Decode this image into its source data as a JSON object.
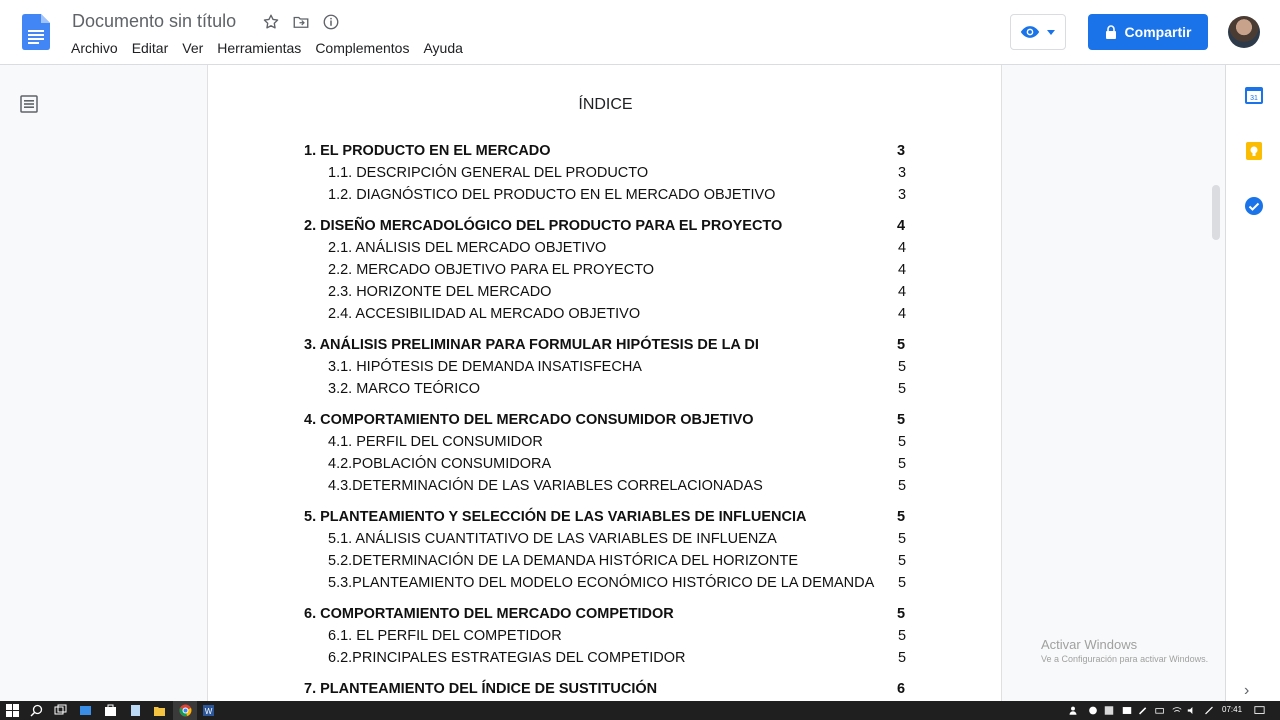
{
  "app": {
    "doc_title": "Documento sin título",
    "menu": [
      "Archivo",
      "Editar",
      "Ver",
      "Herramientas",
      "Complementos",
      "Ayuda"
    ],
    "share_label": "Compartir",
    "brand_color": "#1a73e8"
  },
  "document": {
    "heading": "ÍNDICE",
    "toc": [
      {
        "label": "1. EL PRODUCTO EN EL MERCADO",
        "page": "3",
        "level": 1
      },
      {
        "label": "1.1. DESCRIPCIÓN GENERAL DEL PRODUCTO",
        "page": "3",
        "level": 2
      },
      {
        "label": "1.2. DIAGNÓSTICO DEL PRODUCTO EN EL MERCADO OBJETIVO",
        "page": "3",
        "level": 2
      },
      {
        "label": "2. DISEÑO MERCADOLÓGICO DEL PRODUCTO PARA EL PROYECTO",
        "page": "4",
        "level": 1
      },
      {
        "label": "2.1. ANÁLISIS DEL MERCADO OBJETIVO",
        "page": "4",
        "level": 2
      },
      {
        "label": "2.2. MERCADO OBJETIVO PARA EL PROYECTO",
        "page": "4",
        "level": 2
      },
      {
        "label": "2.3. HORIZONTE DEL MERCADO",
        "page": "4",
        "level": 2
      },
      {
        "label": "2.4. ACCESIBILIDAD AL MERCADO OBJETIVO",
        "page": "4",
        "level": 2
      },
      {
        "label": "3. ANÁLISIS PRELIMINAR PARA FORMULAR HIPÓTESIS DE LA DI",
        "page": "5",
        "level": 1
      },
      {
        "label": "3.1. HIPÓTESIS DE DEMANDA INSATISFECHA",
        "page": "5",
        "level": 2
      },
      {
        "label": "3.2. MARCO TEÓRICO",
        "page": "5",
        "level": 2
      },
      {
        "label": "4. COMPORTAMIENTO DEL MERCADO CONSUMIDOR OBJETIVO",
        "page": "5",
        "level": 1
      },
      {
        "label": "4.1. PERFIL DEL CONSUMIDOR",
        "page": "5",
        "level": 2
      },
      {
        "label": "4.2.POBLACIÓN CONSUMIDORA",
        "page": "5",
        "level": 2
      },
      {
        "label": "4.3.DETERMINACIÓN DE LAS VARIABLES CORRELACIONADAS",
        "page": "5",
        "level": 2
      },
      {
        "label": "5. PLANTEAMIENTO Y SELECCIÓN DE LAS VARIABLES DE INFLUENCIA",
        "page": "5",
        "level": 1
      },
      {
        "label": "5.1. ANÁLISIS CUANTITATIVO DE LAS VARIABLES DE INFLUENZA",
        "page": "5",
        "level": 2
      },
      {
        "label": "5.2.DETERMINACIÓN DE LA DEMANDA HISTÓRICA DEL HORIZONTE",
        "page": "5",
        "level": 2
      },
      {
        "label": "5.3.PLANTEAMIENTO DEL MODELO ECONÓMICO HISTÓRICO DE LA DEMANDA",
        "page": "5",
        "level": 2
      },
      {
        "label": "6. COMPORTAMIENTO DEL MERCADO COMPETIDOR",
        "page": "5",
        "level": 1
      },
      {
        "label": "6.1. EL PERFIL DEL COMPETIDOR",
        "page": "5",
        "level": 2
      },
      {
        "label": "6.2.PRINCIPALES ESTRATEGIAS DEL COMPETIDOR",
        "page": "5",
        "level": 2
      },
      {
        "label": "7. PLANTEAMIENTO DEL ÍNDICE DE SUSTITUCIÓN",
        "page": "6",
        "level": 1
      }
    ]
  },
  "side_panel": {
    "calendar_day": "31"
  },
  "watermark": {
    "line1": "Activar Windows",
    "line2": "Ve a Configuración para activar Windows."
  },
  "taskbar": {
    "time": "07:41"
  }
}
